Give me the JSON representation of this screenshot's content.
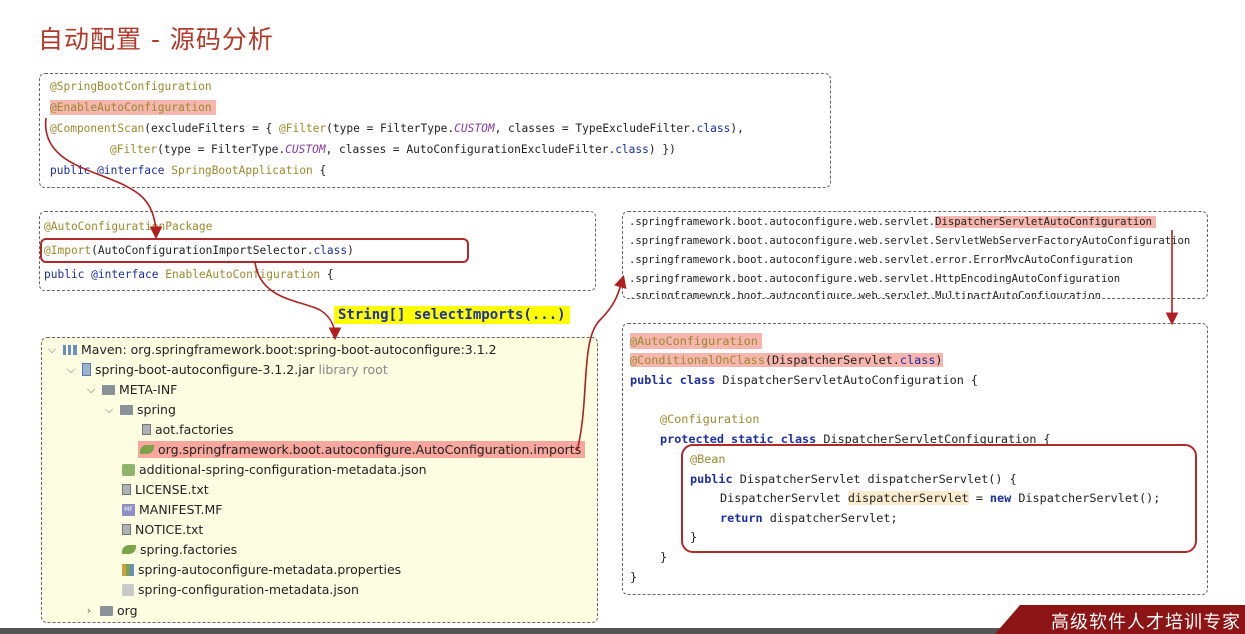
{
  "title": "自动配置 - 源码分析",
  "box1": {
    "l1": "@SpringBootConfiguration",
    "l2": "@EnableAutoConfiguration",
    "l3a": "@ComponentScan",
    "l3b": "(excludeFilters = { ",
    "l3c": "@Filter",
    "l3d": "(type = FilterType.",
    "l3e": "CUSTOM",
    "l3f": ", classes = TypeExcludeFilter.",
    "l3g": "class",
    "l3h": "),",
    "l4a": "@Filter",
    "l4b": "(type = FilterType.",
    "l4c": "CUSTOM",
    "l4d": ", classes = AutoConfigurationExcludeFilter.",
    "l4e": "class",
    "l4f": ") })",
    "l5a": "public ",
    "l5b": "@interface ",
    "l5c": "SpringBootApplication",
    "l5d": " {"
  },
  "box2": {
    "l1": "@AutoConfigurationPackage",
    "l2a": "@Import",
    "l2b": "(AutoConfigurationImportSelector.",
    "l2c": "class",
    "l2d": ")",
    "l3a": "public ",
    "l3b": "@interface ",
    "l3c": "EnableAutoConfiguration",
    "l3d": " {"
  },
  "callout": "String[] selectImports(...)",
  "imports": {
    "prefix": ".springframework.boot.autoconfigure.web.servlet.",
    "l1_hl": "DispatcherServletAutoConfiguration",
    "l2": ".springframework.boot.autoconfigure.web.servlet.ServletWebServerFactoryAutoConfiguration",
    "l3": ".springframework.boot.autoconfigure.web.servlet.error.ErrorMvcAutoConfiguration",
    "l4": ".springframework.boot.autoconfigure.web.servlet.HttpEncodingAutoConfiguration",
    "l5": ".springframework.boot.autoconfigure.web.servlet.MultipartAutoConfiguration"
  },
  "tree": {
    "root": "Maven: org.springframework.boot:spring-boot-autoconfigure:3.1.2",
    "jar": "spring-boot-autoconfigure-3.1.2.jar",
    "jar_suffix": "library root",
    "meta": "META-INF",
    "spring": "spring",
    "aot": "aot.factories",
    "imports_file": "org.springframework.boot.autoconfigure.AutoConfiguration.imports",
    "additional": "additional-spring-configuration-metadata.json",
    "license": "LICENSE.txt",
    "manifest": "MANIFEST.MF",
    "notice": "NOTICE.txt",
    "spring_factories": "spring.factories",
    "autoconf_meta": "spring-autoconfigure-metadata.properties",
    "conf_meta": "spring-configuration-metadata.json",
    "org": "org"
  },
  "box4": {
    "l1": "@AutoConfiguration",
    "l2a": "@ConditionalOnClass",
    "l2b": "(DispatcherServlet.",
    "l2c": "class",
    "l2d": ")",
    "l3a": "public class ",
    "l3b": "DispatcherServletAutoConfiguration {",
    "l4": "@Configuration",
    "l5a": "protected static class ",
    "l5b": "DispatcherServletConfiguration {",
    "l6": "@Bean",
    "l7a": "public ",
    "l7b": "DispatcherServlet dispatcherServlet() {",
    "l8a": "DispatcherServlet ",
    "l8b": "dispatcherServlet",
    "l8c": " = ",
    "l8d": "new ",
    "l8e": "DispatcherServlet();",
    "l9a": "return ",
    "l9b": "dispatcherServlet;",
    "l10": "}",
    "l11": "}",
    "l12": "}"
  },
  "badge": "高级软件人才培训专家",
  "colors": {
    "title": "#b33a2a",
    "highlight": "#f6b5ad",
    "arrow": "#b02020",
    "badge": "#8c1414"
  }
}
